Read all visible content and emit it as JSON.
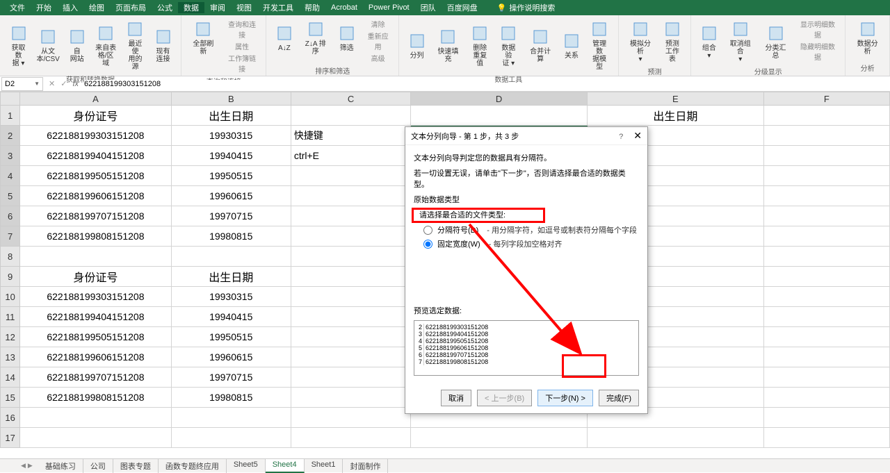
{
  "titlebar": {
    "menus": [
      "文件",
      "开始",
      "插入",
      "绘图",
      "页面布局",
      "公式",
      "数据",
      "审阅",
      "视图",
      "开发工具",
      "帮助",
      "Acrobat",
      "Power Pivot",
      "团队",
      "百度网盘"
    ],
    "active_menu_index": 6,
    "search_placeholder": "操作说明搜索"
  },
  "ribbon": {
    "groups": [
      {
        "label": "获取和转换数据",
        "buttons": [
          {
            "label": "获取数\n据 ▾"
          },
          {
            "label": "从文\n本/CSV"
          },
          {
            "label": "自\n网站"
          },
          {
            "label": "来自表\n格/区域"
          },
          {
            "label": "最近使\n用的源"
          },
          {
            "label": "现有\n连接"
          }
        ]
      },
      {
        "label": "查询和连接",
        "buttons": [
          {
            "label": "全部刷新"
          }
        ],
        "small": [
          {
            "label": "查询和连接"
          },
          {
            "label": "属性"
          },
          {
            "label": "工作簿链接"
          }
        ]
      },
      {
        "label": "排序和筛选",
        "buttons": [
          {
            "label": "A↓Z"
          },
          {
            "label": "Z↓A 排序"
          },
          {
            "label": "筛选"
          }
        ],
        "small": [
          {
            "label": "清除"
          },
          {
            "label": "重新应用"
          },
          {
            "label": "高级"
          }
        ]
      },
      {
        "label": "数据工具",
        "buttons": [
          {
            "label": "分列"
          },
          {
            "label": "快速填充"
          },
          {
            "label": "删除\n重复值"
          },
          {
            "label": "数据验\n证 ▾"
          },
          {
            "label": "合并计算"
          },
          {
            "label": "关系"
          },
          {
            "label": "管理数\n据模型"
          }
        ]
      },
      {
        "label": "预测",
        "buttons": [
          {
            "label": "模拟分析\n▾"
          },
          {
            "label": "预测\n工作表"
          }
        ]
      },
      {
        "label": "分级显示",
        "buttons": [
          {
            "label": "组合\n▾"
          },
          {
            "label": "取消组合\n▾"
          },
          {
            "label": "分类汇总"
          }
        ],
        "small": [
          {
            "label": "显示明细数据"
          },
          {
            "label": "隐藏明细数据"
          }
        ]
      },
      {
        "label": "分析",
        "buttons": [
          {
            "label": "数据分析"
          }
        ]
      }
    ]
  },
  "formula": {
    "name_box": "D2",
    "value": "622188199303151208"
  },
  "columns": [
    "A",
    "B",
    "C",
    "D",
    "E",
    "F"
  ],
  "rows": [
    {
      "n": "1",
      "A": "身份证号",
      "B": "出生日期",
      "C": "",
      "D": "",
      "E": "出生日期",
      "F": ""
    },
    {
      "n": "2",
      "A": "622188199303151208",
      "B": "19930315",
      "C": "快捷键",
      "D": "",
      "E": "",
      "F": ""
    },
    {
      "n": "3",
      "A": "622188199404151208",
      "B": "19940415",
      "C": "ctrl+E",
      "D": "",
      "E": "",
      "F": ""
    },
    {
      "n": "4",
      "A": "622188199505151208",
      "B": "19950515",
      "C": "",
      "D": "",
      "E": "",
      "F": ""
    },
    {
      "n": "5",
      "A": "622188199606151208",
      "B": "19960615",
      "C": "",
      "D": "",
      "E": "",
      "F": ""
    },
    {
      "n": "6",
      "A": "622188199707151208",
      "B": "19970715",
      "C": "",
      "D": "",
      "E": "",
      "F": ""
    },
    {
      "n": "7",
      "A": "622188199808151208",
      "B": "19980815",
      "C": "",
      "D": "",
      "E": "",
      "F": ""
    },
    {
      "n": "8",
      "A": "",
      "B": "",
      "C": "",
      "D": "",
      "E": "",
      "F": ""
    },
    {
      "n": "9",
      "A": "身份证号",
      "B": "出生日期",
      "C": "",
      "D": "",
      "E": "",
      "F": ""
    },
    {
      "n": "10",
      "A": "622188199303151208",
      "B": "19930315",
      "C": "",
      "D": "",
      "E": "",
      "F": ""
    },
    {
      "n": "11",
      "A": "622188199404151208",
      "B": "19940415",
      "C": "",
      "D": "",
      "E": "",
      "F": ""
    },
    {
      "n": "12",
      "A": "622188199505151208",
      "B": "19950515",
      "C": "",
      "D": "",
      "E": "",
      "F": ""
    },
    {
      "n": "13",
      "A": "622188199606151208",
      "B": "19960615",
      "C": "",
      "D": "",
      "E": "",
      "F": ""
    },
    {
      "n": "14",
      "A": "622188199707151208",
      "B": "19970715",
      "C": "",
      "D": "",
      "E": "",
      "F": ""
    },
    {
      "n": "15",
      "A": "622188199808151208",
      "B": "19980815",
      "C": "",
      "D": "",
      "E": "",
      "F": ""
    },
    {
      "n": "16",
      "A": "",
      "B": "",
      "C": "",
      "D": "",
      "E": "",
      "F": ""
    },
    {
      "n": "17",
      "A": "",
      "B": "",
      "C": "",
      "D": "",
      "E": "",
      "F": ""
    }
  ],
  "dialog": {
    "title": "文本分列向导 - 第 1 步，共 3 步",
    "line1": "文本分列向导判定您的数据具有分隔符。",
    "line2": "若一切设置无误，请单击\"下一步\"，否则请选择最合适的数据类型。",
    "section_title": "原始数据类型",
    "instruction": "请选择最合适的文件类型:",
    "radio1_label": "分隔符号(D)",
    "radio1_desc": "- 用分隔字符，如逗号或制表符分隔每个字段",
    "radio2_label": "固定宽度(W)",
    "radio2_desc": "- 每列字段加空格对齐",
    "preview_label": "预览选定数据:",
    "preview_lines": [
      {
        "n": "2",
        "t": "622188199303151208"
      },
      {
        "n": "3",
        "t": "622188199404151208"
      },
      {
        "n": "4",
        "t": "622188199505151208"
      },
      {
        "n": "5",
        "t": "622188199606151208"
      },
      {
        "n": "6",
        "t": "622188199707151208"
      },
      {
        "n": "7",
        "t": "622188199808151208"
      }
    ],
    "btn_cancel": "取消",
    "btn_back": "< 上一步(B)",
    "btn_next": "下一步(N) >",
    "btn_finish": "完成(F)"
  },
  "tabs": {
    "list": [
      "基础练习",
      "公司",
      "图表专题",
      "函数专题终应用",
      "Sheet5",
      "Sheet4",
      "Sheet1",
      "封面制作"
    ],
    "active_index": 5
  }
}
